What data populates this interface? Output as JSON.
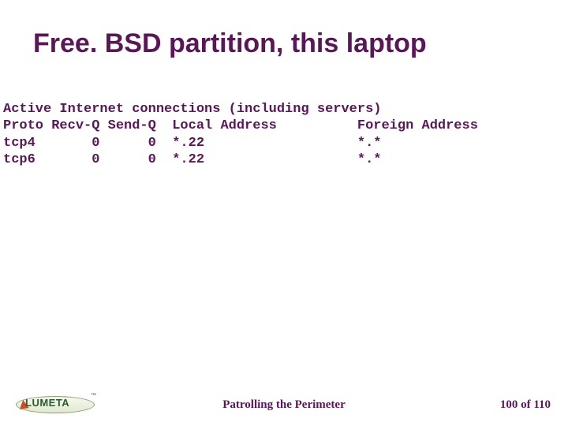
{
  "title": "Free. BSD partition, this laptop",
  "netstat": {
    "header": "Active Internet connections (including servers)",
    "cols": "Proto Recv-Q Send-Q  Local Address          Foreign Address",
    "rows": [
      "tcp4       0      0  *.22                   *.*",
      "tcp6       0      0  *.22                   *.*"
    ]
  },
  "footer": {
    "logo_text": "LUMETA",
    "logo_tm": "™",
    "center": "Patrolling the Perimeter",
    "page": "100 of  110"
  }
}
